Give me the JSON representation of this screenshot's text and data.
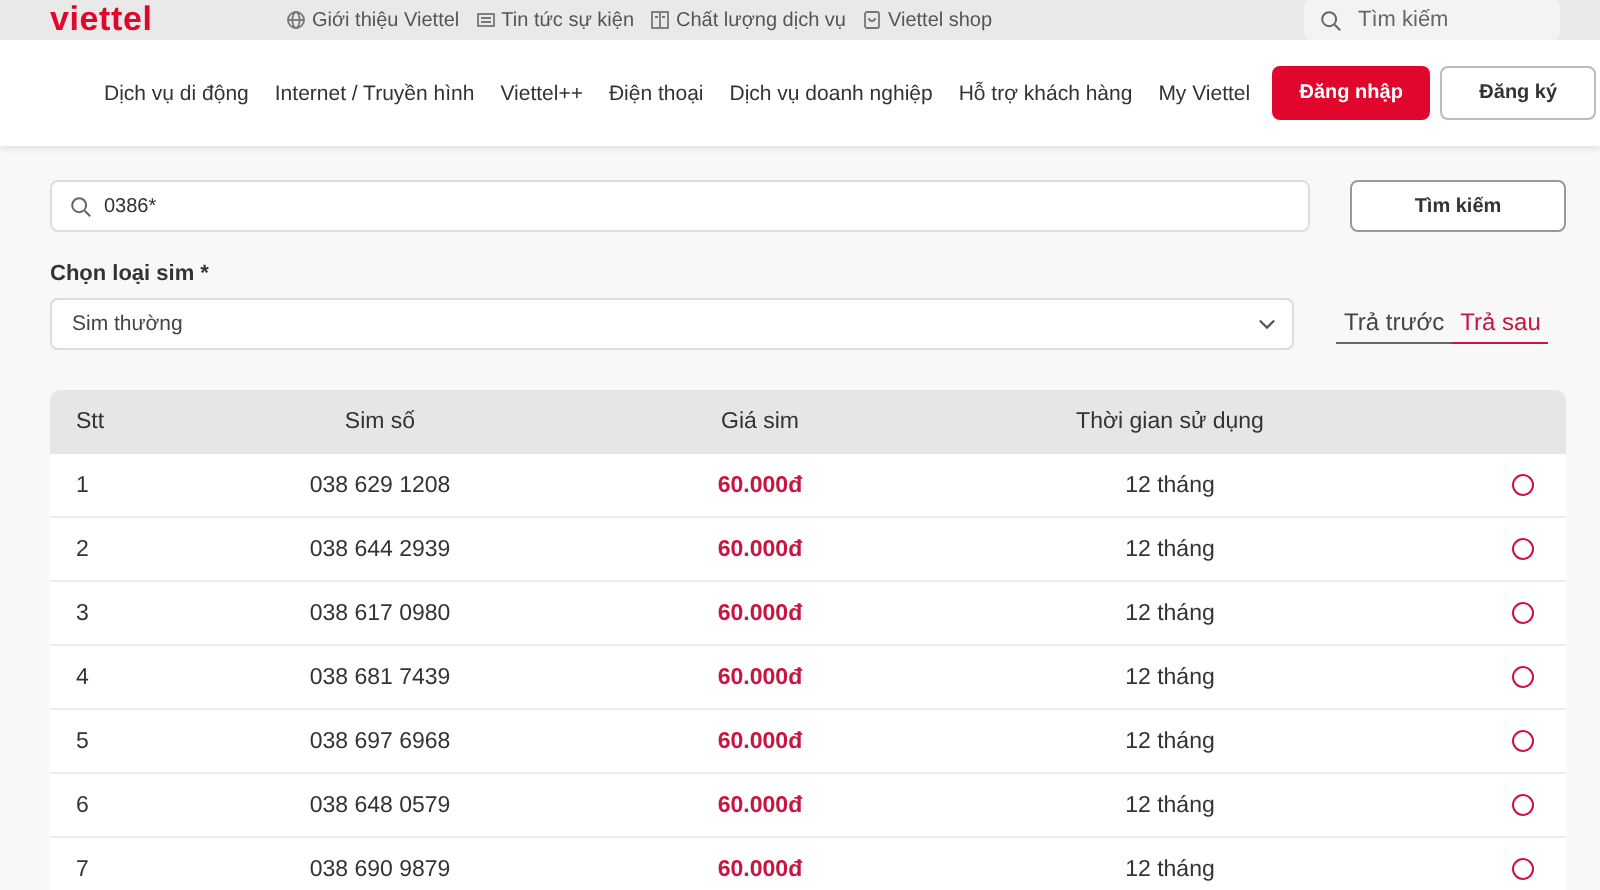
{
  "logo": "viettel",
  "top_links": [
    "Giới thiệu Viettel",
    "Tin tức sự kiện",
    "Chất lượng dịch vụ",
    "Viettel shop"
  ],
  "top_search": {
    "placeholder": "Tìm kiếm"
  },
  "nav": [
    "Dịch vụ di động",
    "Internet / Truyền hình",
    "Viettel++",
    "Điện thoại",
    "Dịch vụ doanh nghiệp",
    "Hỗ trợ khách hàng",
    "My Viettel"
  ],
  "login_button": "Đăng nhập",
  "register_button": "Đăng ký",
  "search": {
    "value": "0386*",
    "button": "Tìm kiếm"
  },
  "sim_type": {
    "label": "Chọn loại sim *",
    "value": "Sim thường"
  },
  "tabs": [
    {
      "label": "Trả trước",
      "selected": false
    },
    {
      "label": "Trả sau",
      "selected": true
    }
  ],
  "table": {
    "columns": [
      "Stt",
      "Sim số",
      "Giá sim",
      "Thời gian sử dụng"
    ],
    "rows": [
      {
        "stt": "1",
        "number": "038 629 1208",
        "price": "60.000đ",
        "duration": "12 tháng",
        "selected": false
      },
      {
        "stt": "2",
        "number": "038 644 2939",
        "price": "60.000đ",
        "duration": "12 tháng",
        "selected": false
      },
      {
        "stt": "3",
        "number": "038 617 0980",
        "price": "60.000đ",
        "duration": "12 tháng",
        "selected": false
      },
      {
        "stt": "4",
        "number": "038 681 7439",
        "price": "60.000đ",
        "duration": "12 tháng",
        "selected": false
      },
      {
        "stt": "5",
        "number": "038 697 6968",
        "price": "60.000đ",
        "duration": "12 tháng",
        "selected": false
      },
      {
        "stt": "6",
        "number": "038 648 0579",
        "price": "60.000đ",
        "duration": "12 tháng",
        "selected": false
      },
      {
        "stt": "7",
        "number": "038 690 9879",
        "price": "60.000đ",
        "duration": "12 tháng",
        "selected": false
      }
    ]
  }
}
